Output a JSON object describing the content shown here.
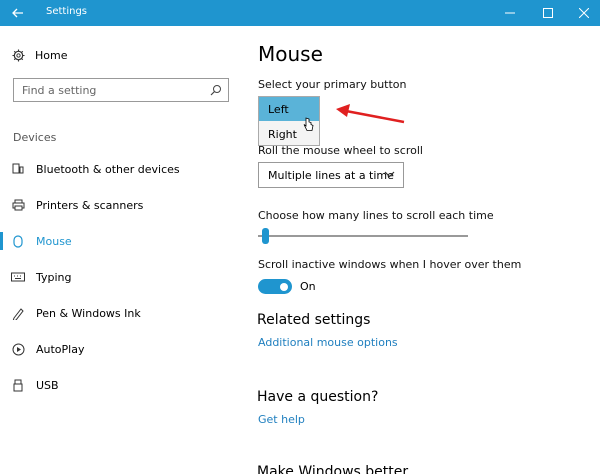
{
  "window": {
    "title": "Settings"
  },
  "nav": {
    "home": "Home",
    "search_placeholder": "Find a setting",
    "section": "Devices",
    "items": [
      {
        "label": "Bluetooth & other devices",
        "icon": "bluetooth-devices-icon"
      },
      {
        "label": "Printers & scanners",
        "icon": "printer-icon"
      },
      {
        "label": "Mouse",
        "icon": "mouse-icon",
        "active": true
      },
      {
        "label": "Typing",
        "icon": "keyboard-icon"
      },
      {
        "label": "Pen & Windows Ink",
        "icon": "pen-icon"
      },
      {
        "label": "AutoPlay",
        "icon": "autoplay-icon"
      },
      {
        "label": "USB",
        "icon": "usb-icon"
      }
    ]
  },
  "main": {
    "title": "Mouse",
    "primary_button_label": "Select your primary button",
    "primary_button_options": [
      "Left",
      "Right"
    ],
    "primary_button_selected": "Left",
    "scroll_label": "Roll the mouse wheel to scroll",
    "scroll_value": "Multiple lines at a time",
    "lines_label": "Choose how many lines to scroll each time",
    "lines_slider_fraction": 0.03,
    "inactive_label": "Scroll inactive windows when I hover over them",
    "inactive_toggle": "On",
    "related_title": "Related settings",
    "related_link": "Additional mouse options",
    "question_title": "Have a question?",
    "help_link": "Get help",
    "better_title": "Make Windows better"
  },
  "colors": {
    "accent": "#1f95cf",
    "arrow": "#e02020",
    "link": "#1f7fbf"
  }
}
